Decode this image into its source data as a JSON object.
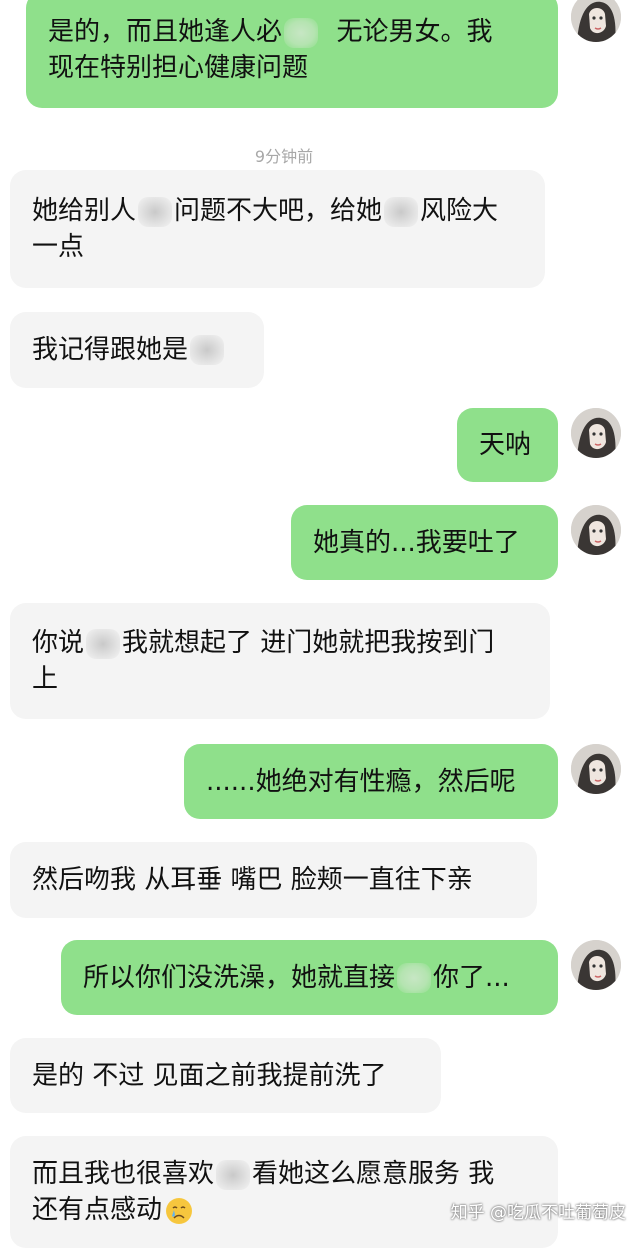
{
  "timestamp": "9分钟前",
  "watermark": "知乎 @吃瓜不吐葡萄皮",
  "messages": [
    {
      "side": "me",
      "parts": [
        "是的，而且她逢人必",
        "无论男女。我",
        "现在特别担心健康问题"
      ]
    },
    {
      "side": "other",
      "parts": [
        "她给别人",
        "问题不大吧，给她",
        "风险大",
        "一点"
      ]
    },
    {
      "side": "other",
      "parts": [
        "我记得跟她是"
      ]
    },
    {
      "side": "me",
      "parts": [
        "天呐"
      ]
    },
    {
      "side": "me",
      "parts": [
        "她真的...我要吐了"
      ]
    },
    {
      "side": "other",
      "parts": [
        "你说",
        "我就想起了 进门她就把我按到门",
        "上"
      ]
    },
    {
      "side": "me",
      "parts": [
        "......她绝对有性瘾，然后呢"
      ]
    },
    {
      "side": "other",
      "parts": [
        "然后吻我 从耳垂 嘴巴 脸颊一直往下亲"
      ]
    },
    {
      "side": "me",
      "parts": [
        "所以你们没洗澡，她就直接",
        "你了..."
      ]
    },
    {
      "side": "other",
      "parts": [
        "是的 不过 见面之前我提前洗了"
      ]
    },
    {
      "side": "other",
      "parts": [
        "而且我也很喜欢",
        "看她这么愿意服务 我",
        "还有点感动"
      ]
    }
  ],
  "colors": {
    "my_bubble": "#8fe08b",
    "other_bubble": "#f4f4f4",
    "background": "#ffffff",
    "text": "#111111"
  },
  "icons": {
    "avatar": "user-avatar-icon",
    "crying_emoji": "crying-face-icon"
  }
}
